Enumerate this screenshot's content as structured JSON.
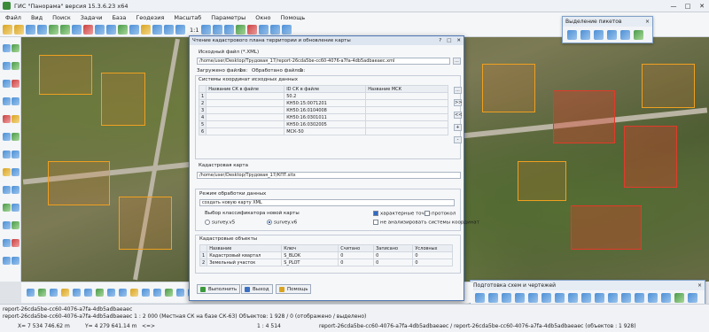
{
  "window": {
    "title": "ГИС \"Панорама\" версия 15.3.6.23 x64",
    "controls": [
      "—",
      "□",
      "✕"
    ]
  },
  "menu": [
    "Файл",
    "Вид",
    "Поиск",
    "Задачи",
    "База",
    "Геодезия",
    "Масштаб",
    "Параметры",
    "Окно",
    "Помощь"
  ],
  "toolbar": {
    "scale_ratio": "1:1"
  },
  "panels": {
    "pickets": {
      "title": "Выделение пикетов",
      "close": "×"
    },
    "schemes": {
      "title": "Подготовка схем и чертежей",
      "close": "×"
    }
  },
  "dialog": {
    "title": "Чтение кадастрового плана территории и обновление карты",
    "source_label": "Исходный файл (*.XML)",
    "source_value": "/home/user/Desktop/Трудовая_17/report-26cda5be-cc60-4076-a7fa-4db5adbaeaec.xml",
    "loaded_label": "Загружено файлов:",
    "loaded_value": "1",
    "processed_label": "Обработано файлов:",
    "processed_value": "1",
    "coords_group": "Системы координат исходных данных",
    "coords_headers": [
      "Название СК в файле",
      "ID СК в файле",
      "Название МСК"
    ],
    "coords_rows": [
      {
        "n": "1",
        "name": "",
        "id": "50.2",
        "msk": ""
      },
      {
        "n": "2",
        "name": "",
        "id": "КН50:15:0071201",
        "msk": ""
      },
      {
        "n": "3",
        "name": "",
        "id": "КН50:16:0104008",
        "msk": ""
      },
      {
        "n": "4",
        "name": "",
        "id": "КН50:16:0301011",
        "msk": ""
      },
      {
        "n": "5",
        "name": "",
        "id": "КН50:16:0302005",
        "msk": ""
      },
      {
        "n": "6",
        "name": "",
        "id": "МСК-50",
        "msk": ""
      }
    ],
    "side_buttons": [
      "...",
      ">>",
      "<<",
      "+",
      "-"
    ],
    "cadastral_map_label": "Кадастровая карта",
    "cadastral_map_value": "/home/user/Desktop/Трудовая_17/КПТ.sitx",
    "mode_group": "Режим обработки данных",
    "mode_value": "создать новую карту XML",
    "classifier_label": "Выбор классификатора новой карты",
    "radio_v5": "survey.v5",
    "radio_v6": "survey.v6",
    "check_points": "характерные точки",
    "check_protocol": "протокол",
    "check_noanalyze": "не анализировать системы координат",
    "objects_group": "Кадастровые объекты",
    "objects_headers": [
      "Название",
      "Ключ",
      "Считано",
      "Записано",
      "Условных"
    ],
    "objects_rows": [
      {
        "n": "1",
        "name": "Кадастровый квартал",
        "key": "S_BLOK",
        "read": "0",
        "written": "0",
        "cond": "0"
      },
      {
        "n": "2",
        "name": "Земельный участок",
        "key": "S_PLOT",
        "read": "0",
        "written": "0",
        "cond": "0"
      }
    ],
    "buttons": {
      "run": "Выполнить",
      "exit": "Выход",
      "help": "Помощь"
    }
  },
  "status": {
    "line1": "report-26cda5be-cc60-4076-a7fa-4db5adbaeaec",
    "line2": "report-26cda5be-cc60-4076-a7fa-4db5adbaeaec   1 : 2 000 (Местная СК на базе СК-63) Объектов: 1 928 / 0 (отображено / выделено)",
    "x": "X= 7 534 746.62 m",
    "y": "Y= 4 279 641.14 m",
    "arrows": "<=>",
    "scale": "1 : 4 514",
    "map_info": "report-26cda5be-cc60-4076-a7fa-4db5adbaeaec / report-26cda5be-cc60-4076-a7fa-4db5adbaeaec   (объектов : 1 928)"
  }
}
